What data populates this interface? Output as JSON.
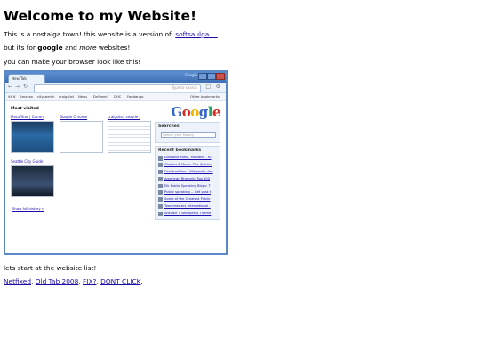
{
  "heading": "Welcome to my Website!",
  "intro": {
    "text": "This is a nostalga town! this website is a version of: ",
    "link": "softsaulga....",
    "suffix": ""
  },
  "line2": {
    "prefix": "but its for ",
    "bold": "google",
    "mid": " and ",
    "italic": "more",
    "suffix": " websites!"
  },
  "line3": "you can make your browser look like this!",
  "screenshot": {
    "tab_label": "New Tab",
    "title_right": "Google",
    "omnibox_hint": "Type to search",
    "bookmarks_bar": [
      "94.6",
      "Amazon",
      "cityseerch",
      "craigslist",
      "News",
      "DnPanel",
      "DHC",
      "Fandango"
    ],
    "other_bookmarks": "Other bookmarks",
    "most_visited_title": "Most visited",
    "thumbnails": [
      "MetaFilter | Comm",
      "Google Chrome",
      "craigslist: seattle l",
      "Seattle City Guide"
    ],
    "google_logo": "Google",
    "search_panel_title": "Searches",
    "search_placeholder": "Search your history",
    "recent_title": "Recent bookmarks",
    "recent_bookmarks": [
      "Dinosaur Fans - Facilities - Ki",
      "Charles & Marie: The Quintes",
      "Oral tradition - Wikipedia, the",
      "American Rhetoric: Top 100",
      "Elk Public Speaking Blogs: T",
      "Public speaking -- Get past t",
      "Some of the Greatest Public",
      "Toastmasters International -",
      "WikiWik » Wordpress Theme"
    ],
    "history_link": "Show full history »"
  },
  "line4": "lets start at the website list!",
  "links": [
    "Netfixed",
    "Old Tab 2008",
    "FIX?",
    "DONT CLICK"
  ],
  "colors": {
    "link": "#1a0dab",
    "frame_border": "#5a87c5",
    "title_bar": "#4a7cc2"
  }
}
